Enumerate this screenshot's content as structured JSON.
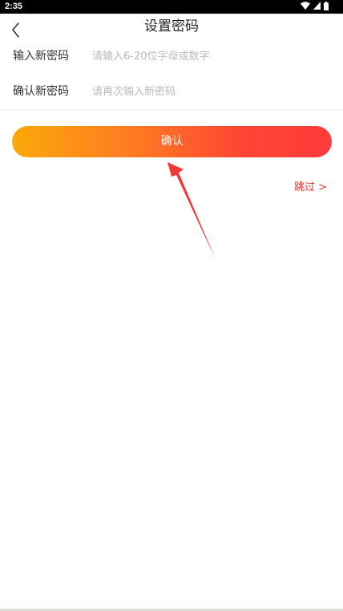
{
  "status_bar": {
    "time": "2:35",
    "icons": [
      "wifi-icon",
      "cellular-signal-icon",
      "battery-icon"
    ]
  },
  "header": {
    "title": "设置密码",
    "back_icon": "chevron-left-icon"
  },
  "form": {
    "new_password": {
      "label": "输入新密码",
      "value": "",
      "placeholder": "请输入6-20位字母或数字"
    },
    "confirm_password": {
      "label": "确认新密码",
      "value": "",
      "placeholder": "请再次输入新密码"
    }
  },
  "confirm_button": {
    "label": "确认"
  },
  "skip": {
    "label": "跳过 >"
  },
  "annotation": {
    "icon": "red-arrow-icon"
  },
  "colors": {
    "button_gradient_start": "#fca80a",
    "button_gradient_end": "#ff3b3b",
    "skip_text": "#e53935",
    "annotation_arrow": "#f03a3a"
  }
}
